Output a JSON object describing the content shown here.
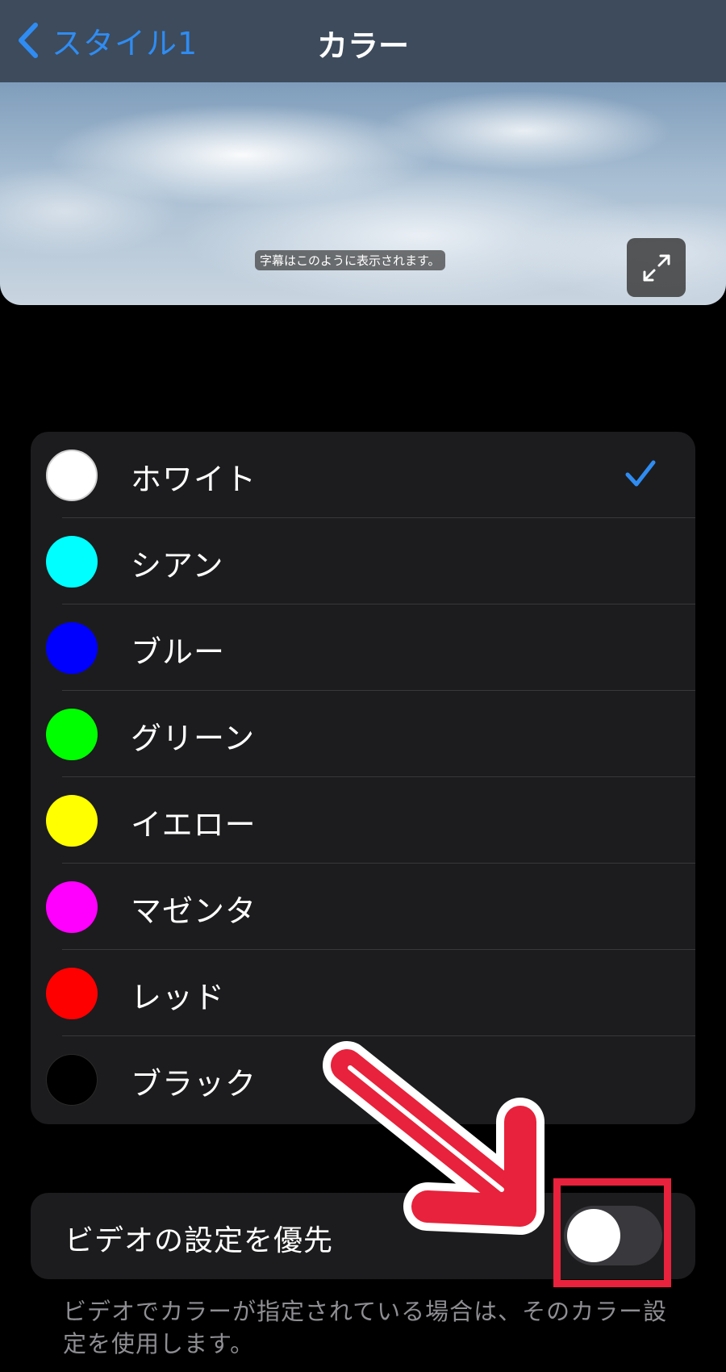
{
  "nav": {
    "back_label": "スタイル1",
    "title": "カラー"
  },
  "preview": {
    "caption_sample": "字幕はこのように表示されます。"
  },
  "colors": [
    {
      "label": "ホワイト",
      "swatch": "#ffffff",
      "selected": true
    },
    {
      "label": "シアン",
      "swatch": "#00ffff",
      "selected": false
    },
    {
      "label": "ブルー",
      "swatch": "#0000ff",
      "selected": false
    },
    {
      "label": "グリーン",
      "swatch": "#00ff00",
      "selected": false
    },
    {
      "label": "イエロー",
      "swatch": "#ffff00",
      "selected": false
    },
    {
      "label": "マゼンタ",
      "swatch": "#ff00ff",
      "selected": false
    },
    {
      "label": "レッド",
      "swatch": "#ff0000",
      "selected": false
    },
    {
      "label": "ブラック",
      "swatch": "#000000",
      "selected": false
    }
  ],
  "preference": {
    "label": "ビデオの設定を優先",
    "enabled": false
  },
  "footnote": "ビデオでカラーが指定されている場合は、そのカラー設定を使用します。",
  "theme": {
    "accent": "#2f8cf2",
    "annotation": "#e8223c"
  }
}
